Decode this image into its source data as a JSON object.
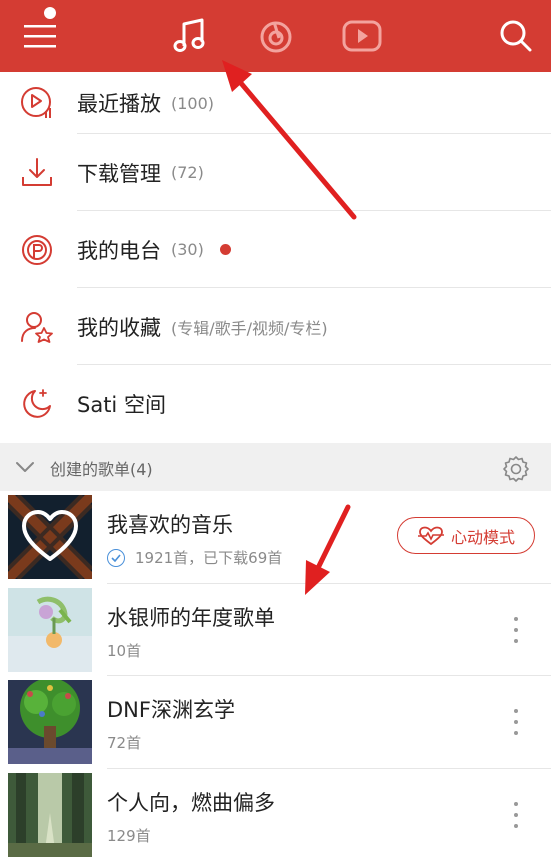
{
  "colors": {
    "accent": "#d43c33",
    "divider": "#e6e6e6",
    "secondary_text": "#8a8a8a"
  },
  "topbar": {
    "icons": [
      "menu-icon",
      "music-note-icon",
      "netease-radio-icon",
      "video-play-icon",
      "search-icon"
    ],
    "active_tab": "music"
  },
  "menu": [
    {
      "label": "最近播放",
      "count": "(100)",
      "icon": "recent-play-icon"
    },
    {
      "label": "下载管理",
      "count": "(72)",
      "icon": "download-icon"
    },
    {
      "label": "我的电台",
      "count": "(30)",
      "icon": "radio-station-icon"
    },
    {
      "label": "我的收藏",
      "count": "(专辑/歌手/视频/专栏)",
      "icon": "favorites-icon"
    },
    {
      "label": "Sati 空间",
      "count": "",
      "icon": "moon-icon"
    }
  ],
  "section": {
    "title": "创建的歌单(4)"
  },
  "playlists": [
    {
      "title": "我喜欢的音乐",
      "subtitle": "1921首，已下载69首",
      "badge": "心动模式"
    },
    {
      "title": "水银师的年度歌单",
      "subtitle": "10首"
    },
    {
      "title": "DNF深渊玄学",
      "subtitle": "72首"
    },
    {
      "title": "个人向，燃曲偏多",
      "subtitle": "129首"
    }
  ]
}
